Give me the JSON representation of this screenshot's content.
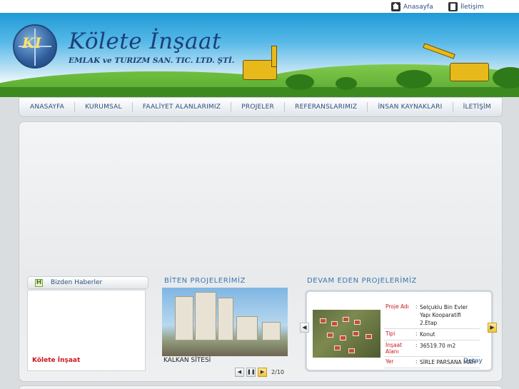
{
  "topbar": {
    "home_label": "Anasayfa",
    "contact_label": "İletişim"
  },
  "header": {
    "logo_initials": "KI",
    "company_name": "Kölete İnşaat",
    "company_subtitle": "EMLAK ve TURIZM SAN. TIC. LTD. ŞTİ."
  },
  "nav": {
    "items": [
      {
        "label": "ANASAYFA"
      },
      {
        "label": "KURUMSAL"
      },
      {
        "label": "FAALİYET ALANLARIMIZ"
      },
      {
        "label": "PROJELER"
      },
      {
        "label": "REFERANSLARIMIZ"
      },
      {
        "label": "İNSAN KAYNAKLARI"
      },
      {
        "label": "İLETİŞİM"
      }
    ]
  },
  "news": {
    "title": "Bizden Haberler",
    "icon_letter": "H",
    "items": [
      "Kölete İnşaat"
    ]
  },
  "completed": {
    "title": "BİTEN PROJELERİMİZ",
    "caption": "KALKAN SİTESİ",
    "pager": "2/10",
    "controls": {
      "prev": "◀",
      "pause": "❚❚",
      "next": "▶"
    }
  },
  "ongoing": {
    "title": "DEVAM EDEN PROJELERİMİZ",
    "rows": [
      {
        "key": "Proje Adı",
        "value": "Selçuklu Bin Evler Yapı Kooparatifi 2.Etap"
      },
      {
        "key": "Tipi",
        "value": "Konut"
      },
      {
        "key": "İnşaat Alanı",
        "value": "36519.70 m2"
      },
      {
        "key": "Yer",
        "value": "SİRLE PARSANA MAH"
      }
    ],
    "detail_label": "Detay",
    "arrows": {
      "left": "◀",
      "right": "▶"
    }
  },
  "icons": {
    "home": "home-icon",
    "contact": "building-icon",
    "news": "news-h-icon"
  },
  "colors": {
    "nav_text": "#2b4f7c",
    "accent_red": "#c8181e",
    "section_title": "#3a77b0",
    "brand_blue": "#1c3f78"
  }
}
